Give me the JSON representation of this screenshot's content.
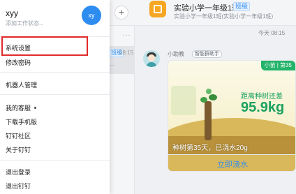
{
  "chat": {
    "group_title": "实验小学一年级1班",
    "group_tag": "班级",
    "group_subtitle": "实验小学一年级1班(实验小学一年级1班)",
    "time_divider": "今天 08:15",
    "plus_label": "+",
    "list": {
      "more": "...",
      "tag": "班级",
      "time": "08:15",
      "preview": "..."
    },
    "bot_name": "小助教",
    "bot_badge": "智能群助手",
    "card": {
      "label": "小苗 | 第35",
      "distance_text": "距离种树还差",
      "remaining_kg": "95.9kg",
      "day_text": "种树第35天，已浇水20g",
      "action": "立即浇水"
    }
  },
  "menu": {
    "user_name": "xyy",
    "user_status": "添加工作状态...",
    "avatar_text": "xy",
    "items": {
      "settings": "系统设置",
      "password": "修改密码",
      "robot": "机器人管理",
      "service": "我的客服",
      "download": "下载手机版",
      "community": "钉钉社区",
      "about": "关于钉钉",
      "logout": "退出登录",
      "quit": "退出钉钉"
    }
  },
  "colors": {
    "accent": "#2d8cf0",
    "highlight_border": "#e02a2a",
    "tree_green": "#1aa160",
    "group_icon": "#f5a623"
  }
}
